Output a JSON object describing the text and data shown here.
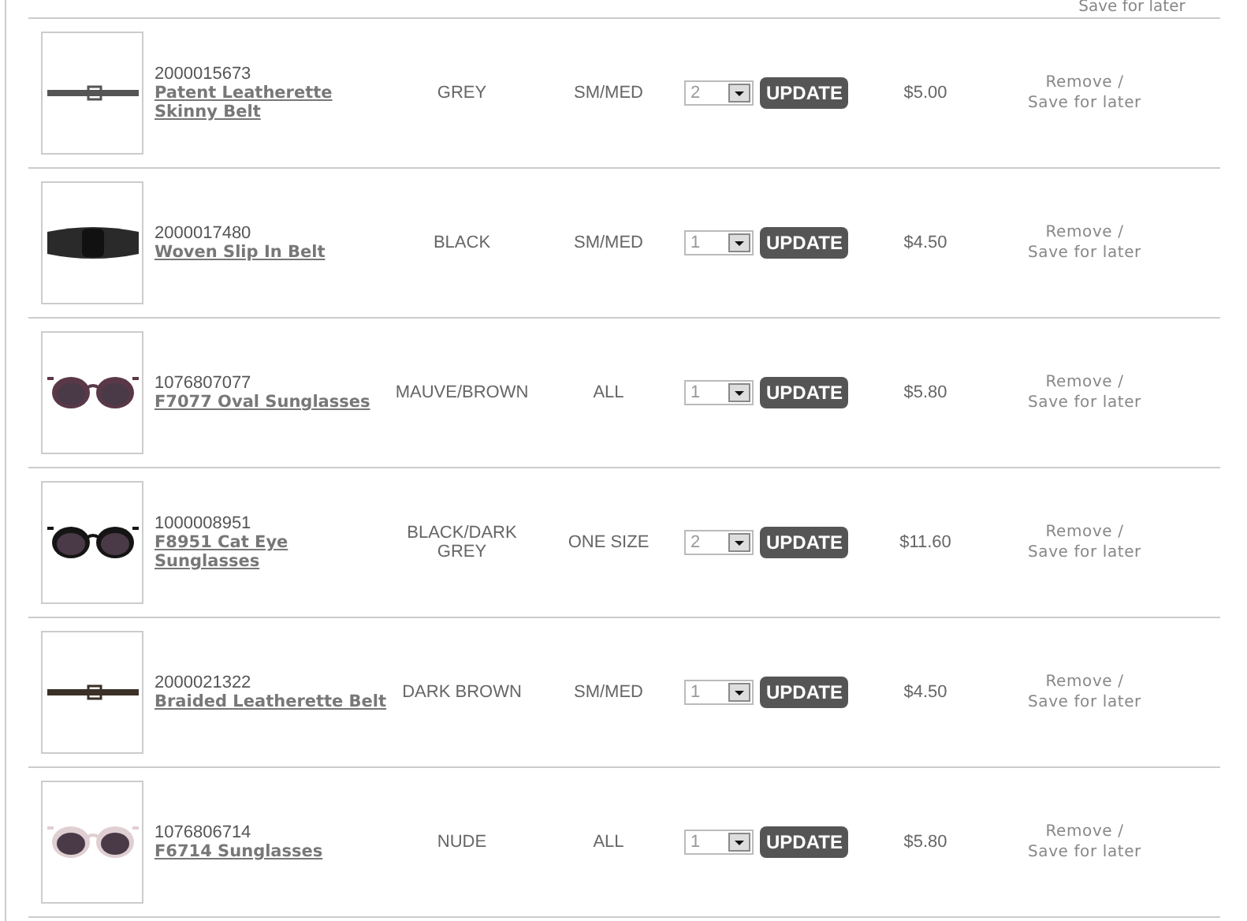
{
  "top_row": {
    "action": "Save for later"
  },
  "items": [
    {
      "kind": "belt",
      "color": "#555555",
      "code": "2000015673",
      "name": "Patent Leatherette Skinny Belt",
      "item_color": "GREY",
      "size": "SM/MED",
      "quantity": "2",
      "update": "UPDATE",
      "price": "$5.00",
      "remove": "Remove /",
      "save": "Save for later"
    },
    {
      "kind": "wide-belt",
      "color": "#2a2a2a",
      "code": "2000017480",
      "name": "Woven Slip In Belt",
      "item_color": "BLACK",
      "size": "SM/MED",
      "quantity": "1",
      "update": "UPDATE",
      "price": "$4.50",
      "remove": "Remove /",
      "save": "Save for later"
    },
    {
      "kind": "sunglasses",
      "color": "#5a3848",
      "code": "1076807077",
      "name": "F7077 Oval Sunglasses",
      "item_color": "MAUVE/BROWN",
      "size": "ALL",
      "quantity": "1",
      "update": "UPDATE",
      "price": "$5.80",
      "remove": "Remove /",
      "save": "Save for later"
    },
    {
      "kind": "sunglasses",
      "color": "#151515",
      "code": "1000008951",
      "name": "F8951 Cat Eye Sunglasses",
      "item_color": "BLACK/DARK GREY",
      "size": "ONE SIZE",
      "quantity": "2",
      "update": "UPDATE",
      "price": "$11.60",
      "remove": "Remove /",
      "save": "Save for later"
    },
    {
      "kind": "belt",
      "color": "#3a3026",
      "code": "2000021322",
      "name": "Braided Leatherette Belt",
      "item_color": "DARK BROWN",
      "size": "SM/MED",
      "quantity": "1",
      "update": "UPDATE",
      "price": "$4.50",
      "remove": "Remove /",
      "save": "Save for later"
    },
    {
      "kind": "sunglasses",
      "color": "#e0cfd2",
      "code": "1076806714",
      "name": "F6714 Sunglasses",
      "item_color": "NUDE",
      "size": "ALL",
      "quantity": "1",
      "update": "UPDATE",
      "price": "$5.80",
      "remove": "Remove /",
      "save": "Save for later"
    }
  ]
}
